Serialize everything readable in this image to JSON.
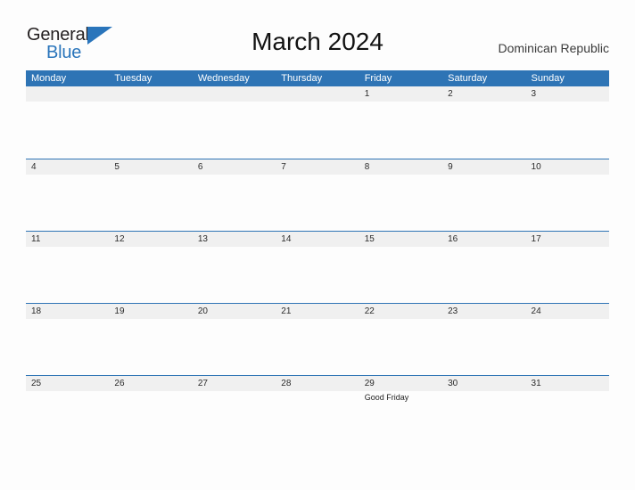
{
  "header": {
    "logo": {
      "name": "General Blue",
      "word_top": "General",
      "word_bottom": "Blue",
      "triangle_icon": "triangle-icon",
      "color_text": "#231f20",
      "color_accent": "#2a75bb"
    },
    "title": "March 2024",
    "locale": "Dominican Republic"
  },
  "calendar": {
    "month": "March",
    "year": "2024",
    "header_color": "#2e74b5",
    "band_color": "#f0f0f0",
    "weekdays": [
      "Monday",
      "Tuesday",
      "Wednesday",
      "Thursday",
      "Friday",
      "Saturday",
      "Sunday"
    ],
    "weeks": [
      [
        {
          "day": ""
        },
        {
          "day": ""
        },
        {
          "day": ""
        },
        {
          "day": ""
        },
        {
          "day": "1"
        },
        {
          "day": "2"
        },
        {
          "day": "3"
        }
      ],
      [
        {
          "day": "4"
        },
        {
          "day": "5"
        },
        {
          "day": "6"
        },
        {
          "day": "7"
        },
        {
          "day": "8"
        },
        {
          "day": "9"
        },
        {
          "day": "10"
        }
      ],
      [
        {
          "day": "11"
        },
        {
          "day": "12"
        },
        {
          "day": "13"
        },
        {
          "day": "14"
        },
        {
          "day": "15"
        },
        {
          "day": "16"
        },
        {
          "day": "17"
        }
      ],
      [
        {
          "day": "18"
        },
        {
          "day": "19"
        },
        {
          "day": "20"
        },
        {
          "day": "21"
        },
        {
          "day": "22"
        },
        {
          "day": "23"
        },
        {
          "day": "24"
        }
      ],
      [
        {
          "day": "25"
        },
        {
          "day": "26"
        },
        {
          "day": "27"
        },
        {
          "day": "28"
        },
        {
          "day": "29",
          "event": "Good Friday"
        },
        {
          "day": "30"
        },
        {
          "day": "31"
        }
      ]
    ]
  }
}
